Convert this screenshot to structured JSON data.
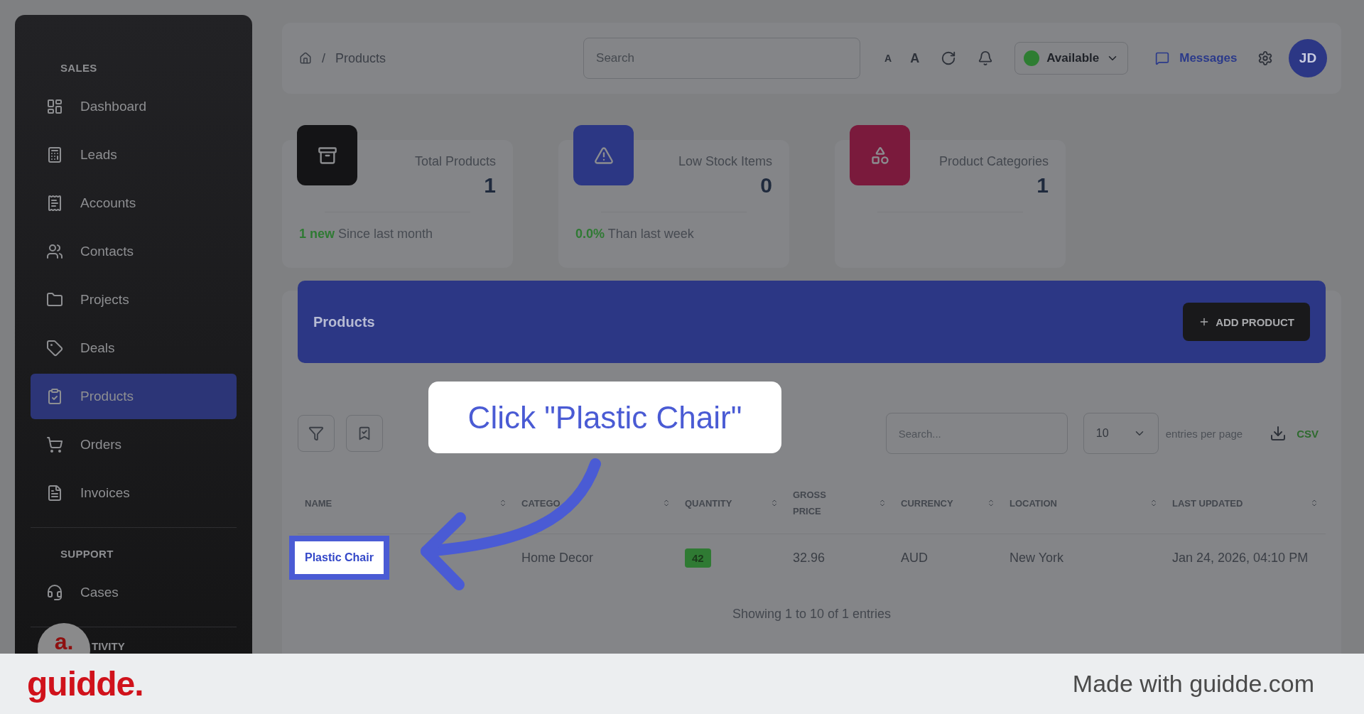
{
  "sidebar": {
    "sections": [
      {
        "title": "SALES",
        "items": [
          {
            "label": "Dashboard",
            "selected": false
          },
          {
            "label": "Leads",
            "selected": false
          },
          {
            "label": "Accounts",
            "selected": false
          },
          {
            "label": "Contacts",
            "selected": false
          },
          {
            "label": "Projects",
            "selected": false
          },
          {
            "label": "Deals",
            "selected": false
          },
          {
            "label": "Products",
            "selected": true
          },
          {
            "label": "Orders",
            "selected": false
          },
          {
            "label": "Invoices",
            "selected": false
          }
        ]
      },
      {
        "title": "SUPPORT",
        "items": [
          {
            "label": "Cases",
            "selected": false
          }
        ]
      }
    ],
    "partial_section": "TIVITY",
    "guide_badge": "a."
  },
  "top_bar": {
    "breadcrumb_separator": "/",
    "breadcrumb": "Products",
    "search": {
      "placeholder": "Search"
    },
    "text_size_buttons": [
      "A",
      "A"
    ],
    "status": {
      "label": "Available",
      "color": "#2e7d32"
    },
    "messages": "Messages",
    "avatar": "JD"
  },
  "stats": [
    {
      "title": "Total Products",
      "value": "1",
      "delta": "1 new",
      "note": "Since last month",
      "color": "#141416"
    },
    {
      "title": "Low Stock Items",
      "value": "0",
      "delta": "0.0%",
      "note": "Than last week",
      "color": "#2c3784"
    },
    {
      "title": "Product Categories",
      "value": "1",
      "color": "#7a1a3c"
    }
  ],
  "products": {
    "title": "Products",
    "add_button": "ADD PRODUCT",
    "search": {
      "placeholder": "Search..."
    },
    "per_page": "10",
    "per_page_label": "entries per page",
    "export": "CSV",
    "columns": [
      "NAME",
      "CATEGO",
      "QUANTITY",
      "GROSS PRICE",
      "CURRENCY",
      "LOCATION",
      "LAST UPDATED"
    ],
    "rows": [
      {
        "name": "Plastic Chair",
        "highlighted": true,
        "category": "Home Decor",
        "quantity": "42",
        "gross_price": "32.96",
        "currency": "AUD",
        "location": "New York",
        "last_updated": "Jan 24, 2026, 04:10 PM"
      }
    ],
    "footer": "Showing 1 to 10 of 1 entries"
  },
  "callout": {
    "text": "Click \"Plastic Chair\""
  },
  "banner": {
    "logo": "guidde.",
    "text": "Made with guidde.com"
  }
}
